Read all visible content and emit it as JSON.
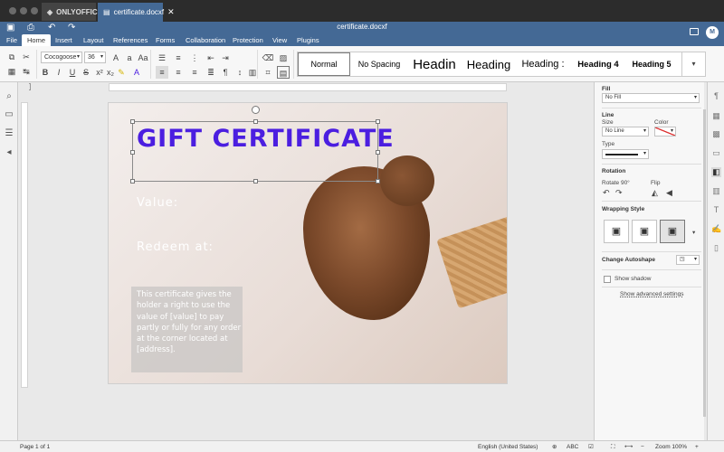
{
  "titlebar": {
    "app_name": "ONLYOFFICE",
    "tab_title": "certificate.docxf",
    "close_glyph": "✕"
  },
  "header": {
    "document_title": "certificate.docxf",
    "avatar_initial": "M",
    "menu": [
      "File",
      "Home",
      "Insert",
      "Layout",
      "References",
      "Forms",
      "Collaboration",
      "Protection",
      "View",
      "Plugins"
    ],
    "active_menu": "Home"
  },
  "toolbar": {
    "font_name": "Cocogoose",
    "font_size": "36",
    "styles": [
      "Normal",
      "No Spacing",
      "Headin",
      "Heading",
      "Heading :",
      "Heading 4",
      "Heading 5"
    ],
    "selected_style": "Normal"
  },
  "document": {
    "title": "GIFT CERTIFICATE",
    "value_label": "Value:",
    "redeem_label": "Redeem at:",
    "info_text": "This certificate gives the holder a right to use the value of [value] to pay partly or fully for any order at the corner located at [address]."
  },
  "right_panel": {
    "fill_heading": "Fill",
    "fill_value": "No Fill",
    "line_heading": "Line",
    "size_label": "Size",
    "size_value": "No Line",
    "color_label": "Color",
    "type_label": "Type",
    "rotation_heading": "Rotation",
    "rotate_label": "Rotate 90°",
    "flip_label": "Flip",
    "wrapping_heading": "Wrapping Style",
    "change_autoshape": "Change Autoshape",
    "show_shadow": "Show shadow",
    "advanced_settings": "Show advanced settings"
  },
  "statusbar": {
    "page_info": "Page 1 of 1",
    "language": "English (United States)",
    "zoom": "Zoom 100%"
  },
  "colors": {
    "header_blue": "#446995",
    "title_purple": "#4b1ee0"
  }
}
